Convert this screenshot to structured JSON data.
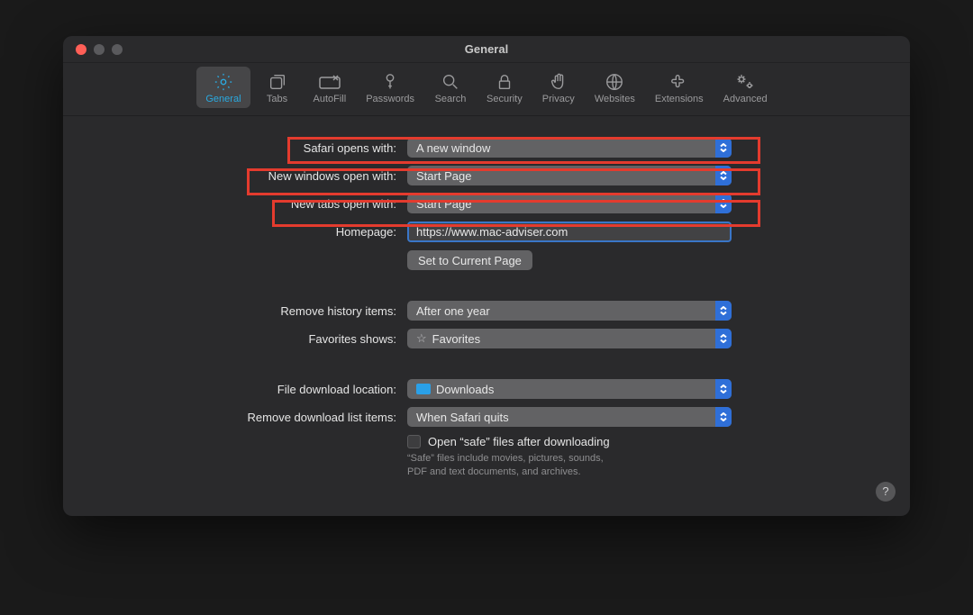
{
  "window": {
    "title": "General"
  },
  "toolbar": {
    "items": [
      {
        "id": "general",
        "label": "General",
        "active": true
      },
      {
        "id": "tabs",
        "label": "Tabs"
      },
      {
        "id": "autofill",
        "label": "AutoFill"
      },
      {
        "id": "passwords",
        "label": "Passwords"
      },
      {
        "id": "search",
        "label": "Search"
      },
      {
        "id": "security",
        "label": "Security"
      },
      {
        "id": "privacy",
        "label": "Privacy"
      },
      {
        "id": "websites",
        "label": "Websites"
      },
      {
        "id": "extensions",
        "label": "Extensions"
      },
      {
        "id": "advanced",
        "label": "Advanced"
      }
    ]
  },
  "form": {
    "safari_opens": {
      "label": "Safari opens with:",
      "value": "A new window"
    },
    "new_windows": {
      "label": "New windows open with:",
      "value": "Start Page"
    },
    "new_tabs": {
      "label": "New tabs open with:",
      "value": "Start Page"
    },
    "homepage": {
      "label": "Homepage:",
      "value": "https://www.mac-adviser.com"
    },
    "set_current": "Set to Current Page",
    "remove_history": {
      "label": "Remove history items:",
      "value": "After one year"
    },
    "favorites": {
      "label": "Favorites shows:",
      "value": "Favorites"
    },
    "download_location": {
      "label": "File download location:",
      "value": "Downloads"
    },
    "remove_downloads": {
      "label": "Remove download list items:",
      "value": "When Safari quits"
    },
    "open_safe": {
      "label": "Open “safe” files after downloading",
      "hint": "“Safe” files include movies, pictures, sounds,\nPDF and text documents, and archives."
    }
  },
  "help": "?"
}
